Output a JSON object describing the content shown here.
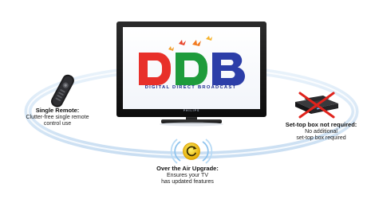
{
  "logo": {
    "text": "DDB",
    "tagline": "DIGITAL DIRECT BROADCAST",
    "colors": {
      "d1": "#e8302a",
      "d2": "#1e9b3c",
      "b": "#2c3ea8"
    }
  },
  "tv": {
    "brand": "PHILIPS"
  },
  "features": [
    {
      "title": "Single Remote:",
      "line1": "Clutter-free single remote",
      "line2": "control use",
      "icon": "remote-control-icon"
    },
    {
      "title": "Set-top box not required:",
      "line1": "No additional",
      "line2": "set-top box required",
      "icon": "crossed-out-set-top-box-icon"
    },
    {
      "title": "Over the Air Upgrade:",
      "line1": "Ensures your TV",
      "line2": "has updated features",
      "icon": "wireless-update-icon"
    }
  ],
  "colors": {
    "orbit": "#d6e7f6",
    "accent_yellow": "#f2c400",
    "cross_red": "#e0231c"
  }
}
